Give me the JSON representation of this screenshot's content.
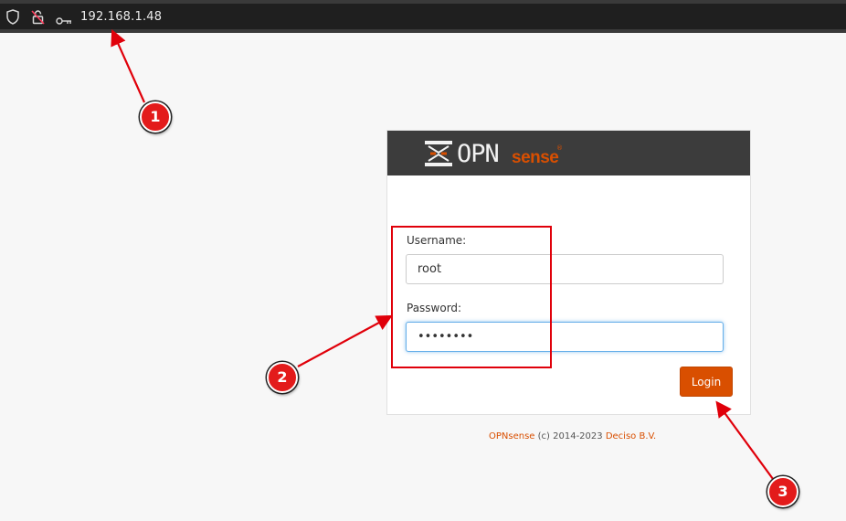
{
  "browser": {
    "url": "192.168.1.48",
    "icons": [
      "shield-icon",
      "lock-crossed-icon",
      "key-icon"
    ]
  },
  "login": {
    "brand_primary": "OPN",
    "brand_secondary": "sense",
    "brand_mark": "®",
    "username_label": "Username:",
    "username_value": "root",
    "password_label": "Password:",
    "password_value": "password",
    "login_label": "Login"
  },
  "footer": {
    "product": "OPNsense",
    "copyright": "(c) 2014-2023",
    "company": "Deciso B.V."
  },
  "annotations": [
    "1",
    "2",
    "3"
  ],
  "colors": {
    "accent": "#d94f00",
    "header_bg": "#3c3c3c",
    "annotation": "#e31b1b",
    "focus": "#66afe9"
  }
}
